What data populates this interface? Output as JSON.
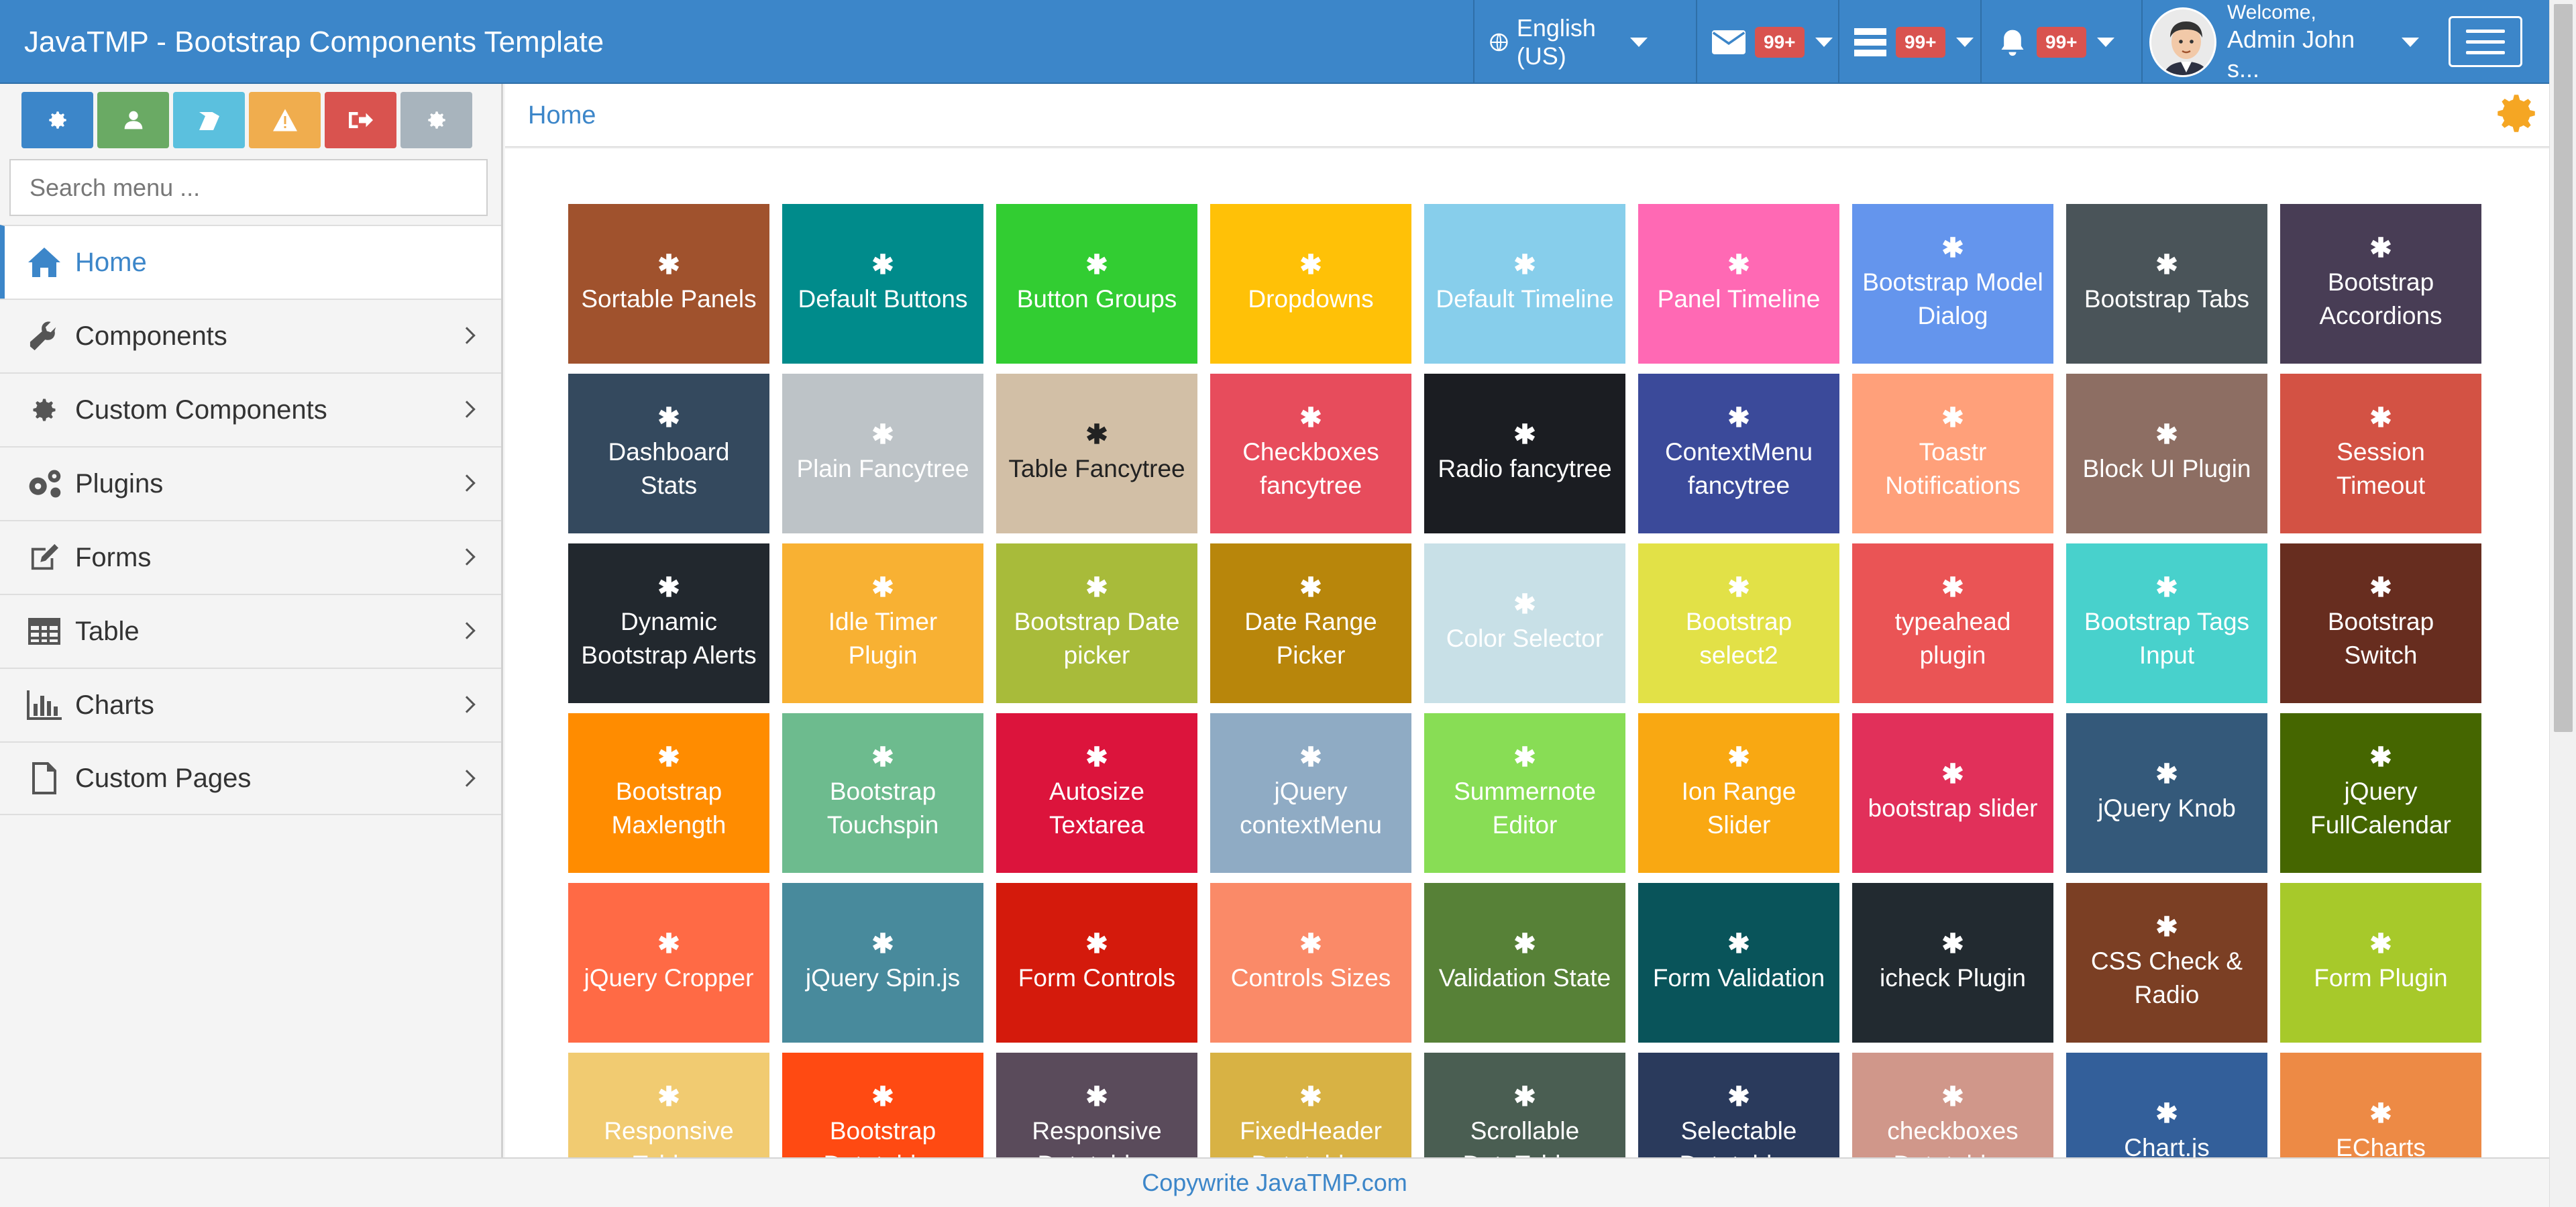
{
  "navbar": {
    "brand": "JavaTMP - Bootstrap Components Template",
    "language": "English (US)",
    "messages_badge": "99+",
    "tasks_badge": "99+",
    "notifications_badge": "99+",
    "welcome_label": "Welcome,",
    "user_name": "Admin John s..."
  },
  "sidebar": {
    "quick_buttons": [
      {
        "name": "settings",
        "color": "#3c86c9"
      },
      {
        "name": "user",
        "color": "#6aaa64"
      },
      {
        "name": "book",
        "color": "#5bc0de"
      },
      {
        "name": "warning",
        "color": "#f0ad4e"
      },
      {
        "name": "logout",
        "color": "#d9534f"
      },
      {
        "name": "settings-alt",
        "color": "#a8b4bd"
      }
    ],
    "search_placeholder": "Search menu ...",
    "menu": [
      {
        "label": "Home",
        "icon": "home-icon",
        "active": true
      },
      {
        "label": "Components",
        "icon": "wrench-icon"
      },
      {
        "label": "Custom Components",
        "icon": "gear-icon"
      },
      {
        "label": "Plugins",
        "icon": "gears-icon"
      },
      {
        "label": "Forms",
        "icon": "edit-icon"
      },
      {
        "label": "Table",
        "icon": "table-icon"
      },
      {
        "label": "Charts",
        "icon": "bar-chart-icon"
      },
      {
        "label": "Custom Pages",
        "icon": "file-icon"
      }
    ]
  },
  "breadcrumb": {
    "home": "Home"
  },
  "tiles": [
    {
      "label": "Sortable Panels",
      "color": "#a0522d"
    },
    {
      "label": "Default Buttons",
      "color": "#008b8b"
    },
    {
      "label": "Button Groups",
      "color": "#32cd32"
    },
    {
      "label": "Dropdowns",
      "color": "#ffc107"
    },
    {
      "label": "Default Timeline",
      "color": "#87ceeb"
    },
    {
      "label": "Panel Timeline",
      "color": "#ff69b4"
    },
    {
      "label": "Bootstrap Model Dialog",
      "color": "#6495ed"
    },
    {
      "label": "Bootstrap Tabs",
      "color": "#4a5459"
    },
    {
      "label": "Bootstrap Accordions",
      "color": "#483d55"
    },
    {
      "label": "Dashboard Stats",
      "color": "#34495e"
    },
    {
      "label": "Plain Fancytree",
      "color": "#bdc3c7"
    },
    {
      "label": "Table Fancytree",
      "color": "#d2bfa6",
      "dark": true
    },
    {
      "label": "Checkboxes fancytree",
      "color": "#e74c5c"
    },
    {
      "label": "Radio fancytree",
      "color": "#1b1d22"
    },
    {
      "label": "ContextMenu fancytree",
      "color": "#3b4a9a"
    },
    {
      "label": "Toastr Notifications",
      "color": "#ffa07a"
    },
    {
      "label": "Block UI Plugin",
      "color": "#8d6e63"
    },
    {
      "label": "Session Timeout",
      "color": "#d35244"
    },
    {
      "label": "Dynamic Bootstrap Alerts",
      "color": "#22282e"
    },
    {
      "label": "Idle Timer Plugin",
      "color": "#f8b133"
    },
    {
      "label": "Bootstrap Date picker",
      "color": "#a8bb3a"
    },
    {
      "label": "Date Range Picker",
      "color": "#b8860b"
    },
    {
      "label": "Color Selector",
      "color": "#c8e0e7"
    },
    {
      "label": "Bootstrap select2",
      "color": "#e2e147"
    },
    {
      "label": "typeahead plugin",
      "color": "#ea5455"
    },
    {
      "label": "Bootstrap Tags Input",
      "color": "#48d1cc"
    },
    {
      "label": "Bootstrap Switch",
      "color": "#672d1f"
    },
    {
      "label": "Bootstrap Maxlength",
      "color": "#ff8c00"
    },
    {
      "label": "Bootstrap Touchspin",
      "color": "#6dbb8e"
    },
    {
      "label": "Autosize Textarea",
      "color": "#dc143c"
    },
    {
      "label": "jQuery contextMenu",
      "color": "#8fabc4"
    },
    {
      "label": "Summernote Editor",
      "color": "#88dd55"
    },
    {
      "label": "Ion Range Slider",
      "color": "#f9a812"
    },
    {
      "label": "bootstrap slider",
      "color": "#e1305a"
    },
    {
      "label": "jQuery Knob",
      "color": "#34597a"
    },
    {
      "label": "jQuery FullCalendar",
      "color": "#456600"
    },
    {
      "label": "jQuery Cropper",
      "color": "#ff6a45"
    },
    {
      "label": "jQuery Spin.js",
      "color": "#488a9c"
    },
    {
      "label": "Form Controls",
      "color": "#d41a0c"
    },
    {
      "label": "Controls Sizes",
      "color": "#fa8a68"
    },
    {
      "label": "Validation State",
      "color": "#578137"
    },
    {
      "label": "Form Validation",
      "color": "#09545a"
    },
    {
      "label": "icheck Plugin",
      "color": "#222a30"
    },
    {
      "label": "CSS Check & Radio",
      "color": "#7b3f24"
    },
    {
      "label": "Form Plugin",
      "color": "#a7c92a"
    },
    {
      "label": "Responsive Tables",
      "color": "#f1cb71"
    },
    {
      "label": "Bootstrap Datatables",
      "color": "#ff4a12"
    },
    {
      "label": "Responsive Datatables",
      "color": "#5a4b5b"
    },
    {
      "label": "FixedHeader Datatables",
      "color": "#d8b244"
    },
    {
      "label": "Scrollable DataTables",
      "color": "#4a5e52"
    },
    {
      "label": "Selectable Datatables",
      "color": "#2a3a5c"
    },
    {
      "label": "checkboxes Datatables",
      "color": "#d0978a"
    },
    {
      "label": "Chart.js",
      "color": "#335f9a"
    },
    {
      "label": "ECharts",
      "color": "#ed8a45"
    }
  ],
  "footer": {
    "text": "Copywrite JavaTMP.com"
  }
}
